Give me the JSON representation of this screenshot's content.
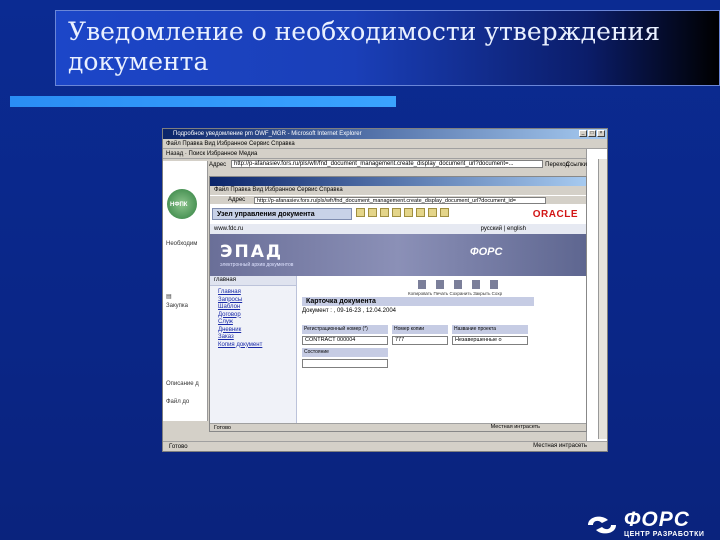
{
  "slide": {
    "title": "Уведомление о необходимости утверждения документа"
  },
  "browser": {
    "window_title": "Подробное уведомление pm OWF_MGR - Microsoft Internet Explorer",
    "menu": "Файл  Правка  Вид  Избранное  Сервис  Справка",
    "nav_toolbar": "Назад   ·   Поиск   Избранное   Медиа",
    "address_label": "Адрес",
    "address_value": "http://p-afanasiev.fors.ru/pls/wfr/fnd_document_management.create_display_document_url?document=...",
    "go_label": "Переход",
    "links_label": "Ссылки",
    "left_labels": [
      "Необходим",
      "Закупка",
      "Описание д",
      "Файл до"
    ],
    "nfpk_label": "НФПК",
    "status_left": "Готово",
    "status_right": "Местная интрасеть"
  },
  "inner_browser": {
    "menu": "Файл  Правка  Вид  Избранное  Сервис  Справка",
    "address_label": "Адрес",
    "address_value": "http://p-afanasiev.fors.ru/pls/wfr/fnd_document_management.create_display_document_url?document_id=",
    "node_title": "Узел управления документа",
    "oracle_logo": "ORACLE",
    "site": "www.fdc.ru",
    "langs": "русский | english",
    "epad_logo": "ЭПАД",
    "epad_sub": "электронный архив документов",
    "fors_banner": "ФОРС",
    "status_left": "Готово",
    "status_right": "Местная интрасеть"
  },
  "card": {
    "menu_home": "главная",
    "menu_items": [
      "Главная",
      "Запросы",
      "Шаблон",
      "Договор",
      "Служ",
      "Дневник",
      "Заказ",
      "Копия документ"
    ],
    "tools_label": "Копировать Печать Сохранить Закрыть Сохр",
    "title": "Карточка документа",
    "document_line": "Документ :  ,  09-16-23 , 12.04.2004",
    "col_headers": [
      "Регистрационный номер (*)",
      "Номер копии",
      "Название проекта"
    ],
    "col_values": [
      "CONTRACT 000004",
      "777",
      "Незавершенные о"
    ],
    "state_label": "Состояние"
  },
  "footer": {
    "fors_logo": "ФОРС",
    "fors_sub": "ЦЕНТР РАЗРАБОТКИ"
  }
}
